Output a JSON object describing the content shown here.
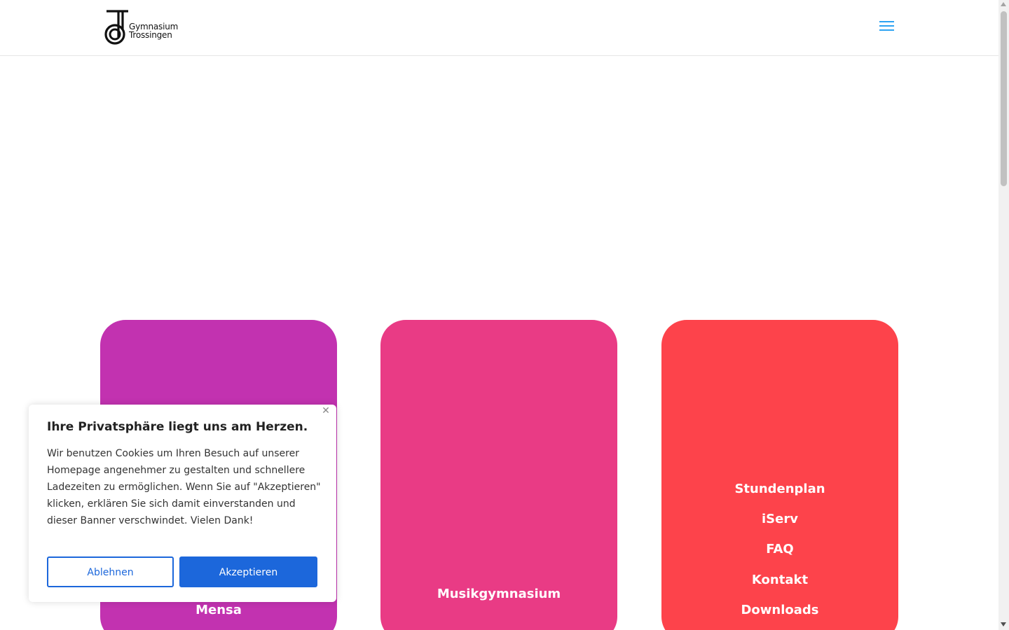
{
  "header": {
    "logo_text_line1": "Gymnasium",
    "logo_text_line2": "Trossingen",
    "menu_icon": "hamburger-menu-icon",
    "accent_color": "#2ea3f2"
  },
  "cards": [
    {
      "color": "#c232b0",
      "links": [
        "Mensa"
      ]
    },
    {
      "color": "#e93b85",
      "links": [
        "Musikgymnasium"
      ]
    },
    {
      "color": "#fd434b",
      "links": [
        "Stundenplan",
        "iServ",
        "FAQ",
        "Kontakt",
        "Downloads"
      ]
    }
  ],
  "cookie_banner": {
    "title": "Ihre Privatsphäre liegt uns am Herzen.",
    "text": "Wir benutzen Cookies um Ihren Besuch auf unserer Homepage angenehmer zu gestalten und schnellere Ladezeiten zu ermöglichen.  Wenn Sie auf \"Akzeptieren\" klicken, erklären Sie sich damit einverstanden und dieser Banner verschwindet. Vielen Dank!",
    "decline_label": "Ablehnen",
    "accept_label": "Akzeptieren",
    "close_icon": "close-icon",
    "button_color": "#1c67db"
  }
}
